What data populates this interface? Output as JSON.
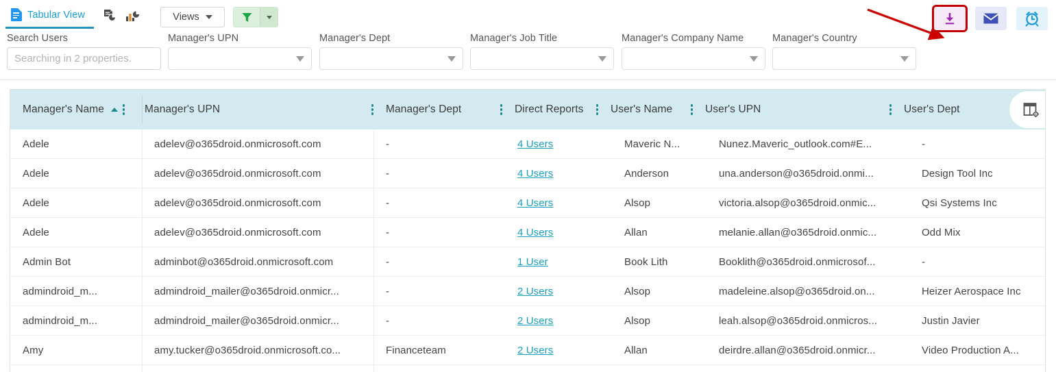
{
  "toolbar": {
    "tab_label": "Tabular View",
    "tab_icon": "document-icon",
    "export_doc_icon": "document-chart-icon",
    "chart_icon": "bar-pie-chart-icon",
    "views_label": "Views",
    "filter_icon": "funnel-icon",
    "filter_split_icon": "chevron-down-icon",
    "download_icon": "download-icon",
    "mail_icon": "envelope-icon",
    "schedule_icon": "alarm-clock-icon",
    "annotation": "red-arrow-pointing-to-download"
  },
  "filters": {
    "search": {
      "label": "Search Users",
      "placeholder": "Searching in 2 properties.",
      "value": ""
    },
    "dropdowns": [
      {
        "label": "Manager's UPN",
        "value": ""
      },
      {
        "label": "Manager's Dept",
        "value": ""
      },
      {
        "label": "Manager's Job Title",
        "value": ""
      },
      {
        "label": "Manager's Company Name",
        "value": ""
      },
      {
        "label": "Manager's Country",
        "value": ""
      }
    ]
  },
  "table": {
    "settings_icon": "table-settings-icon",
    "sort_column": "Manager's Name",
    "sort_direction": "ascending",
    "columns": [
      {
        "label": "Manager's Name",
        "kebab": true,
        "sorted": true
      },
      {
        "label": "Manager's UPN",
        "kebab": true,
        "sorted": false
      },
      {
        "label": "Manager's Dept",
        "kebab": true,
        "sorted": false
      },
      {
        "label": "Direct Reports",
        "kebab": true,
        "sorted": false
      },
      {
        "label": "User's Name",
        "kebab": true,
        "sorted": false
      },
      {
        "label": "User's UPN",
        "kebab": true,
        "sorted": false
      },
      {
        "label": "User's Dept",
        "kebab": false,
        "sorted": false
      }
    ],
    "rows": [
      {
        "manager_name": "Adele",
        "manager_upn": "adelev@o365droid.onmicrosoft.com",
        "manager_dept": "-",
        "direct_reports": "4 Users",
        "user_name": "Maveric N...",
        "user_upn": "Nunez.Maveric_outlook.com#E...",
        "user_dept": "-"
      },
      {
        "manager_name": "Adele",
        "manager_upn": "adelev@o365droid.onmicrosoft.com",
        "manager_dept": "-",
        "direct_reports": "4 Users",
        "user_name": "Anderson",
        "user_upn": "una.anderson@o365droid.onmi...",
        "user_dept": "Design Tool Inc"
      },
      {
        "manager_name": "Adele",
        "manager_upn": "adelev@o365droid.onmicrosoft.com",
        "manager_dept": "-",
        "direct_reports": "4 Users",
        "user_name": "Alsop",
        "user_upn": "victoria.alsop@o365droid.onmic...",
        "user_dept": "Qsi Systems Inc"
      },
      {
        "manager_name": "Adele",
        "manager_upn": "adelev@o365droid.onmicrosoft.com",
        "manager_dept": "-",
        "direct_reports": "4 Users",
        "user_name": "Allan",
        "user_upn": "melanie.allan@o365droid.onmic...",
        "user_dept": "Odd Mix"
      },
      {
        "manager_name": "Admin Bot",
        "manager_upn": "adminbot@o365droid.onmicrosoft.com",
        "manager_dept": "-",
        "direct_reports": "1 User",
        "user_name": "Book Lith",
        "user_upn": "Booklith@o365droid.onmicrosof...",
        "user_dept": "-"
      },
      {
        "manager_name": "admindroid_m...",
        "manager_upn": "admindroid_mailer@o365droid.onmicr...",
        "manager_dept": "-",
        "direct_reports": "2 Users",
        "user_name": "Alsop",
        "user_upn": "madeleine.alsop@o365droid.on...",
        "user_dept": "Heizer Aerospace Inc"
      },
      {
        "manager_name": "admindroid_m...",
        "manager_upn": "admindroid_mailer@o365droid.onmicr...",
        "manager_dept": "-",
        "direct_reports": "2 Users",
        "user_name": "Alsop",
        "user_upn": "leah.alsop@o365droid.onmicros...",
        "user_dept": "Justin Javier"
      },
      {
        "manager_name": "Amy",
        "manager_upn": "amy.tucker@o365droid.onmicrosoft.co...",
        "manager_dept": "Financeteam",
        "direct_reports": "2 Users",
        "user_name": "Allan",
        "user_upn": "deirdre.allan@o365droid.onmicr...",
        "user_dept": "Video Production A..."
      }
    ]
  },
  "colors": {
    "tab_accent": "#1a9ed4",
    "header_band": "#d3eaf0",
    "link": "#19a0c4",
    "kebab": "#1e8a8a",
    "download_accent": "#9b27b0",
    "annotation_red": "#c00000"
  }
}
